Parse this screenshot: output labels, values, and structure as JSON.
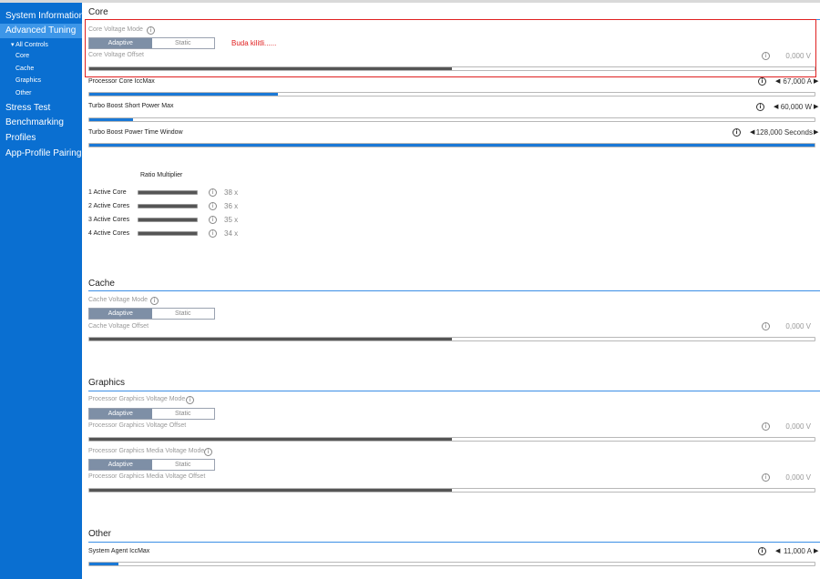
{
  "sidebar": {
    "items": [
      {
        "label": "System Information"
      },
      {
        "label": "Advanced Tuning",
        "selected": true
      },
      {
        "label": "Stress Test"
      },
      {
        "label": "Benchmarking"
      },
      {
        "label": "Profiles"
      },
      {
        "label": "App-Profile Pairing"
      }
    ],
    "subitems": [
      {
        "label": "▾ All Controls"
      },
      {
        "label": "Core"
      },
      {
        "label": "Cache"
      },
      {
        "label": "Graphics"
      },
      {
        "label": "Other"
      }
    ]
  },
  "core": {
    "title": "Core",
    "voltage_mode": {
      "label": "Core Voltage Mode",
      "options": [
        "Adaptive",
        "Static"
      ],
      "selected": "Adaptive"
    },
    "voltage_offset": {
      "label": "Core Voltage Offset",
      "value": "0,000 V",
      "fraction": 0.5
    },
    "annotation": "Buda kilitli......",
    "iccmax": {
      "label": "Processor Core IccMax",
      "value": "67,000 A",
      "fraction": 0.26
    },
    "short_power": {
      "label": "Turbo Boost Short Power Max",
      "value": "60,000 W",
      "fraction": 0.06
    },
    "time_window": {
      "label": "Turbo Boost Power Time Window",
      "value": "128,000 Seconds",
      "fraction": 1.0
    },
    "ratio": {
      "header": "Ratio Multiplier",
      "rows": [
        {
          "label": "1 Active Core",
          "value": "38 x"
        },
        {
          "label": "2 Active Cores",
          "value": "36 x"
        },
        {
          "label": "3 Active Cores",
          "value": "35 x"
        },
        {
          "label": "4 Active Cores",
          "value": "34 x"
        }
      ]
    }
  },
  "cache": {
    "title": "Cache",
    "voltage_mode": {
      "label": "Cache Voltage Mode",
      "options": [
        "Adaptive",
        "Static"
      ],
      "selected": "Adaptive"
    },
    "voltage_offset": {
      "label": "Cache Voltage Offset",
      "value": "0,000 V",
      "fraction": 0.5
    }
  },
  "graphics": {
    "title": "Graphics",
    "voltage_mode": {
      "label": "Processor Graphics Voltage Mode",
      "options": [
        "Adaptive",
        "Static"
      ],
      "selected": "Adaptive"
    },
    "voltage_offset": {
      "label": "Processor Graphics Voltage Offset",
      "value": "0,000 V",
      "fraction": 0.5
    },
    "media_voltage_mode": {
      "label": "Processor Graphics Media Voltage Mode",
      "options": [
        "Adaptive",
        "Static"
      ],
      "selected": "Adaptive"
    },
    "media_voltage_offset": {
      "label": "Processor Graphics Media Voltage Offset",
      "value": "0,000 V",
      "fraction": 0.5
    }
  },
  "other": {
    "title": "Other",
    "system_agent_iccmax": {
      "label": "System Agent IccMax",
      "value": "11,000 A",
      "fraction": 0.04
    }
  },
  "icons": {
    "info": "i",
    "left_arrow": "◀",
    "right_arrow": "▶"
  },
  "colors": {
    "sidebar": "#0a6fd1",
    "sidebar_selected": "#3d96e8",
    "accent": "#1a78d6",
    "annotation": "#e02020"
  }
}
